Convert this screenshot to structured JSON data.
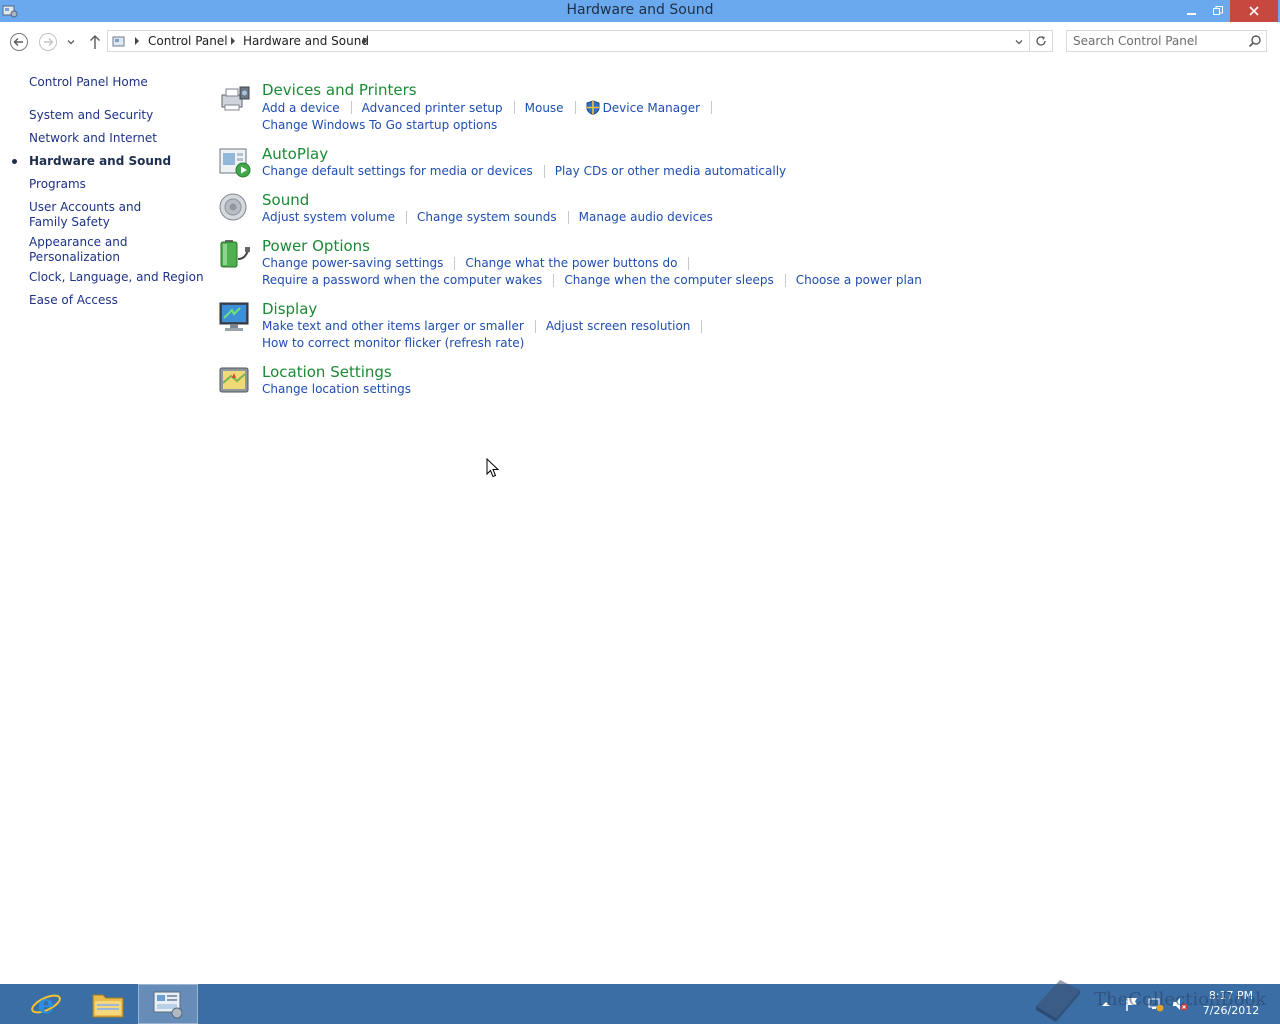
{
  "window": {
    "title": "Hardware and Sound",
    "icon": "control-panel-icon"
  },
  "navigation": {
    "back_icon": "back-arrow-icon",
    "forward_icon": "forward-arrow-icon",
    "recent_icon": "chevron-down-icon",
    "up_icon": "up-arrow-icon",
    "breadcrumbs": [
      "Control Panel",
      "Hardware and Sound"
    ],
    "search_placeholder": "Search Control Panel"
  },
  "sidebar": {
    "home": "Control Panel Home",
    "items": [
      {
        "label": "System and Security"
      },
      {
        "label": "Network and Internet"
      },
      {
        "label": "Hardware and Sound",
        "active": true
      },
      {
        "label": "Programs"
      },
      {
        "label": "User Accounts and Family Safety"
      },
      {
        "label": "Appearance and Personalization"
      },
      {
        "label": "Clock, Language, and Region"
      },
      {
        "label": "Ease of Access"
      }
    ]
  },
  "categories": [
    {
      "title": "Devices and Printers",
      "icon": "printer-icon",
      "links": [
        [
          "Add a device",
          "Advanced printer setup",
          "Mouse",
          "Device Manager"
        ],
        [
          "Change Windows To Go startup options"
        ]
      ]
    },
    {
      "title": "AutoPlay",
      "icon": "autoplay-icon",
      "links": [
        [
          "Change default settings for media or devices",
          "Play CDs or other media automatically"
        ]
      ]
    },
    {
      "title": "Sound",
      "icon": "speaker-icon",
      "links": [
        [
          "Adjust system volume",
          "Change system sounds",
          "Manage audio devices"
        ]
      ]
    },
    {
      "title": "Power Options",
      "icon": "battery-icon",
      "links": [
        [
          "Change power-saving settings",
          "Change what the power buttons do"
        ],
        [
          "Require a password when the computer wakes",
          "Change when the computer sleeps",
          "Choose a power plan"
        ]
      ]
    },
    {
      "title": "Display",
      "icon": "monitor-icon",
      "links": [
        [
          "Make text and other items larger or smaller",
          "Adjust screen resolution"
        ],
        [
          "How to correct monitor flicker (refresh rate)"
        ]
      ]
    },
    {
      "title": "Location Settings",
      "icon": "location-icon",
      "links": [
        [
          "Change location settings"
        ]
      ]
    }
  ],
  "taskbar": {
    "apps": [
      "internet-explorer-icon",
      "file-explorer-icon",
      "control-panel-icon"
    ],
    "clock_time": "8:17 PM",
    "clock_date": "7/26/2012",
    "watermark": "TheCollectionBook"
  },
  "colors": {
    "titlebar": "#6aa9ee",
    "taskbar": "#3a6ea5",
    "category_heading": "#1b8a34",
    "link": "#1f4db0"
  }
}
